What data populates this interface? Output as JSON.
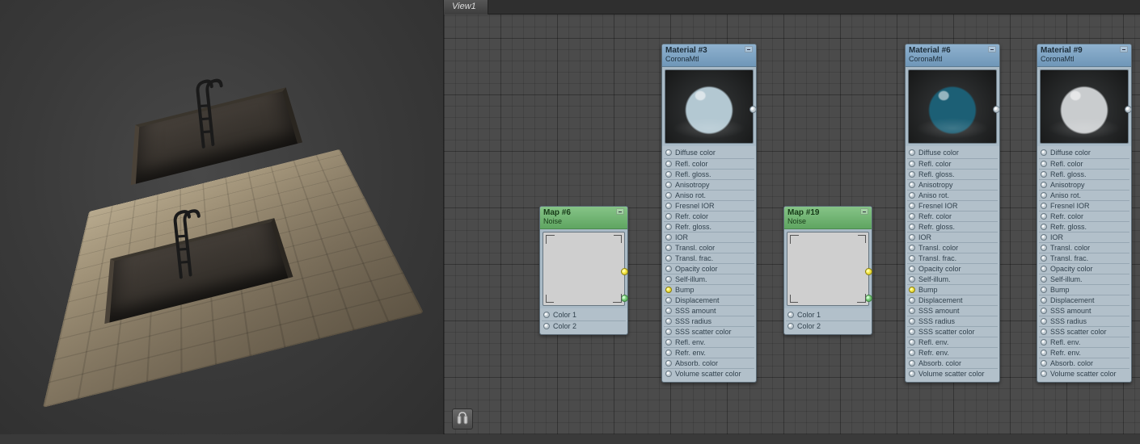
{
  "tab": {
    "label": "View1"
  },
  "maps": [
    {
      "title": "Map #6",
      "subtitle": "Noise",
      "slots": [
        "Color 1",
        "Color 2"
      ]
    },
    {
      "title": "Map #19",
      "subtitle": "Noise",
      "slots": [
        "Color 1",
        "Color 2"
      ]
    }
  ],
  "materials": [
    {
      "title": "Material #3",
      "subtitle": "CoronaMtl",
      "preview": "glass",
      "slots": [
        "Diffuse color",
        "Refl. color",
        "Refl. gloss.",
        "Anisotropy",
        "Aniso rot.",
        "Fresnel IOR",
        "Refr. color",
        "Refr. gloss.",
        "IOR",
        "Transl. color",
        "Transl. frac.",
        "Opacity color",
        "Self-illum.",
        "Bump",
        "Displacement",
        "SSS amount",
        "SSS radius",
        "SSS scatter color",
        "Refl. env.",
        "Refr. env.",
        "Absorb. color",
        "Volume scatter color"
      ],
      "active_slot": "Bump"
    },
    {
      "title": "Material #6",
      "subtitle": "CoronaMtl",
      "preview": "teal",
      "slots": [
        "Diffuse color",
        "Refl. color",
        "Refl. gloss.",
        "Anisotropy",
        "Aniso rot.",
        "Fresnel IOR",
        "Refr. color",
        "Refr. gloss.",
        "IOR",
        "Transl. color",
        "Transl. frac.",
        "Opacity color",
        "Self-illum.",
        "Bump",
        "Displacement",
        "SSS amount",
        "SSS radius",
        "SSS scatter color",
        "Refl. env.",
        "Refr. env.",
        "Absorb. color",
        "Volume scatter color"
      ],
      "active_slot": "Bump"
    },
    {
      "title": "Material #9",
      "subtitle": "CoronaMtl",
      "preview": "grey",
      "slots": [
        "Diffuse color",
        "Refl. color",
        "Refl. gloss.",
        "Anisotropy",
        "Aniso rot.",
        "Fresnel IOR",
        "Refr. color",
        "Refr. gloss.",
        "IOR",
        "Transl. color",
        "Transl. frac.",
        "Opacity color",
        "Self-illum.",
        "Bump",
        "Displacement",
        "SSS amount",
        "SSS radius",
        "SSS scatter color",
        "Refl. env.",
        "Refr. env.",
        "Absorb. color",
        "Volume scatter color"
      ],
      "active_slot": ""
    }
  ],
  "nav_icon": "navigator-icon"
}
